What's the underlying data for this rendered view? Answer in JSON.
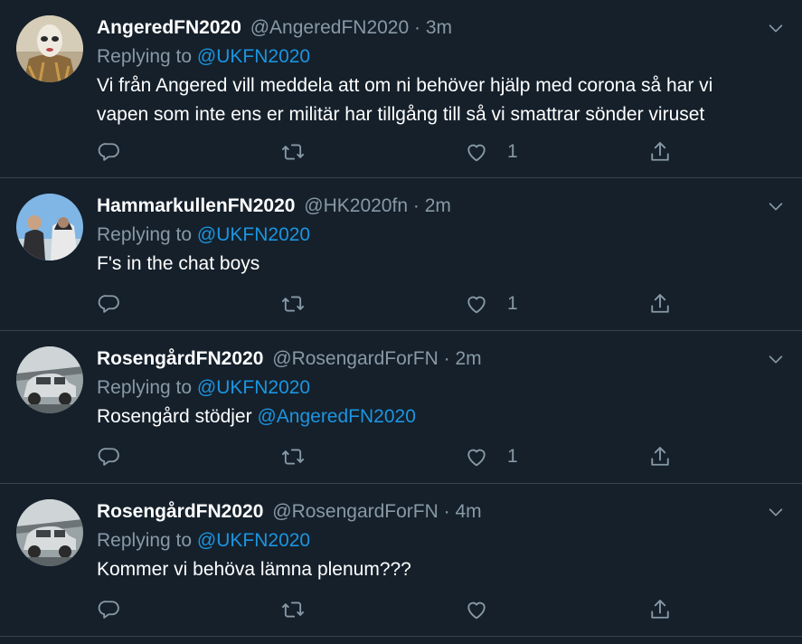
{
  "tweets": [
    {
      "name": "AngeredFN2020",
      "handle": "@AngeredFN2020",
      "sep": "·",
      "time": "3m",
      "replying_prefix": "Replying to",
      "replying_to": "@UKFN2020",
      "text": "Vi från Angered vill meddela att om ni behöver hjälp med corona så har vi vapen som inte ens er militär har tillgång till så vi smattrar sönder viruset",
      "like_count": "1"
    },
    {
      "name": "HammarkullenFN2020",
      "handle": "@HK2020fn",
      "sep": "·",
      "time": "2m",
      "replying_prefix": "Replying to",
      "replying_to": "@UKFN2020",
      "text": "F's in the chat boys",
      "like_count": "1"
    },
    {
      "name": "RosengårdFN2020",
      "handle": "@RosengardForFN",
      "sep": "·",
      "time": "2m",
      "replying_prefix": "Replying to",
      "replying_to": "@UKFN2020",
      "text_prefix": "Rosengård stödjer",
      "mention": "@AngeredFN2020",
      "like_count": "1"
    },
    {
      "name": "RosengårdFN2020",
      "handle": "@RosengardForFN",
      "sep": "·",
      "time": "4m",
      "replying_prefix": "Replying to",
      "replying_to": "@UKFN2020",
      "text": "Kommer vi behöva lämna plenum???"
    }
  ],
  "icons": {
    "reply": "reply-icon",
    "retweet": "retweet-icon",
    "like": "heart-icon",
    "share": "share-icon",
    "more": "chevron-down-icon"
  },
  "colors": {
    "background": "#15202b",
    "divider": "#38444d",
    "secondary_text": "#8899a6",
    "link": "#1b95e0",
    "primary_text": "#ffffff"
  }
}
